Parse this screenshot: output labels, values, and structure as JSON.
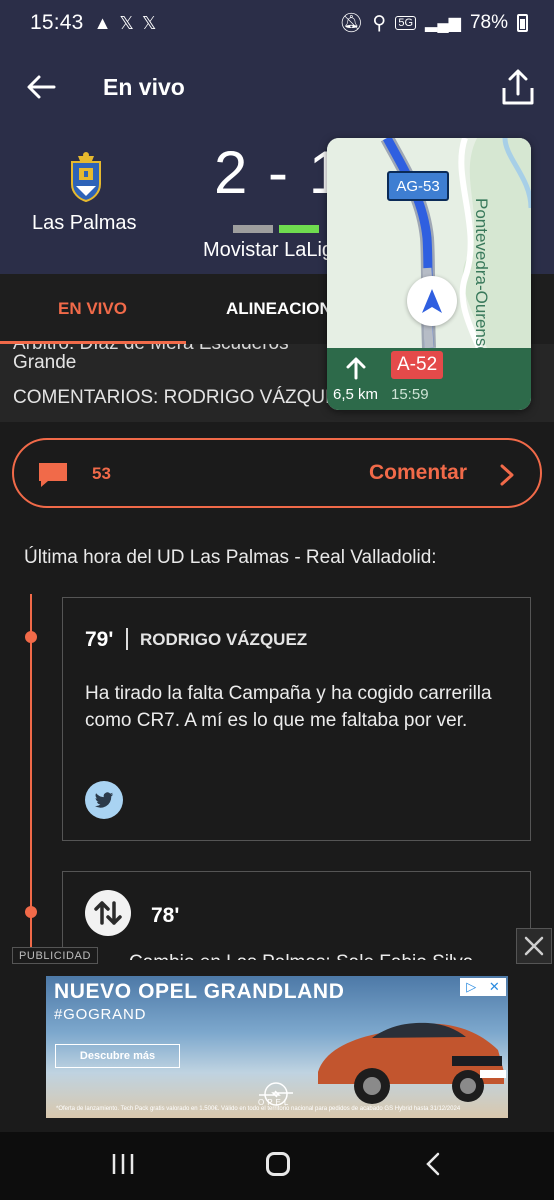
{
  "status_bar": {
    "time": "15:43",
    "network": "5G",
    "battery": "78%"
  },
  "header": {
    "title": "En vivo",
    "home_team": "Las Palmas",
    "score": "2 - 1",
    "competition": "Movistar LaLiga"
  },
  "tabs": [
    {
      "label": "EN VIVO",
      "active": true
    },
    {
      "label": "ALINEACIONES",
      "active": false
    }
  ],
  "info": {
    "clipped_line": "Árbitro: Díaz de Mera Escuderos",
    "line1": "Grande",
    "line2": "COMENTARIOS: RODRIGO VÁZQUEZ"
  },
  "comment_button": {
    "count": "53",
    "label": "Comentar"
  },
  "latest": {
    "title": "Última hora del UD Las Palmas - Real Valladolid:"
  },
  "posts": [
    {
      "minute": "79'",
      "author": "RODRIGO VÁZQUEZ",
      "text": "Ha tirado la falta Campaña y ha cogido carrerilla como CR7. A mí es lo que me faltaba por ver."
    },
    {
      "minute": "78'",
      "text": "Cambio en Las Palmas: Sale Fabio Silva"
    }
  ],
  "ad": {
    "tag": "PUBLICIDAD",
    "headline": "NUEVO OPEL GRANDLAND",
    "hashtag": "#GOGRAND",
    "cta": "Descubre más",
    "brand": "OPEL",
    "fine_print": "*Oferta de lanzamiento. Tech Pack gratis valorado en 1.500€. Válido en todo el territorio nacional para pedidos de acabado GS Hybrid hasta 31/12/2024"
  },
  "navigation_pip": {
    "road_shield": "AG-53",
    "street": "Pontevedra-Ourense",
    "next_road": "A-52",
    "distance": "6,5 km",
    "eta": "15:59"
  },
  "colors": {
    "header_bg": "#2b2e48",
    "accent": "#f16a49",
    "page_bg": "#1b1b1b",
    "form_bars": [
      "#9e9e9e",
      "#6fdc4f",
      "#2b2e48"
    ]
  },
  "icons": {
    "back": "arrow-left-icon",
    "share": "share-icon",
    "comment": "chat-bubble-icon",
    "twitter": "twitter-icon",
    "substitution": "swap-arrows-icon",
    "close": "close-icon"
  }
}
